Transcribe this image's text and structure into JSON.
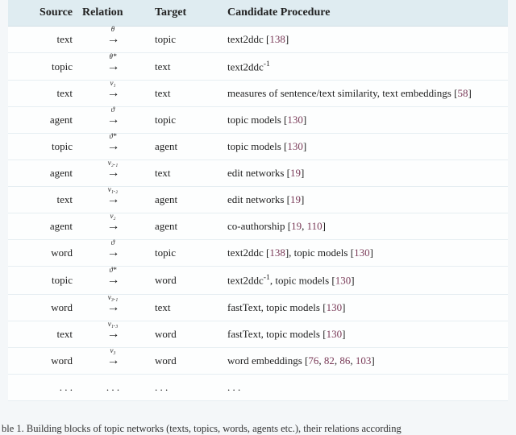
{
  "headers": {
    "source": "Source",
    "relation": "Relation",
    "target": "Target",
    "proc": "Candidate Procedure"
  },
  "rows": [
    {
      "source": "text",
      "rel_symbol": "θ",
      "target": "topic",
      "proc_parts": [
        {
          "t": "text2ddc ["
        },
        {
          "t": "138",
          "cite": true
        },
        {
          "t": "]"
        }
      ]
    },
    {
      "source": "topic",
      "rel_symbol": "θ*",
      "target": "text",
      "proc_parts": [
        {
          "t": "text2ddc"
        },
        {
          "sup": "-1"
        }
      ]
    },
    {
      "source": "text",
      "rel_symbol": "ν₁",
      "target": "text",
      "proc_parts": [
        {
          "t": "measures of sentence/text similarity, text embeddings ["
        },
        {
          "t": "58",
          "cite": true
        },
        {
          "t": "]"
        }
      ]
    },
    {
      "source": "agent",
      "rel_symbol": "ϑ",
      "target": "topic",
      "proc_parts": [
        {
          "t": "topic models ["
        },
        {
          "t": "130",
          "cite": true
        },
        {
          "t": "]"
        }
      ]
    },
    {
      "source": "topic",
      "rel_symbol": "ϑ*",
      "target": "agent",
      "proc_parts": [
        {
          "t": "topic models ["
        },
        {
          "t": "130",
          "cite": true
        },
        {
          "t": "]"
        }
      ]
    },
    {
      "source": "agent",
      "rel_symbol": "ν₂.₁",
      "target": "text",
      "proc_parts": [
        {
          "t": "edit networks ["
        },
        {
          "t": "19",
          "cite": true
        },
        {
          "t": "]"
        }
      ]
    },
    {
      "source": "text",
      "rel_symbol": "ν₁.₂",
      "target": "agent",
      "proc_parts": [
        {
          "t": "edit networks ["
        },
        {
          "t": "19",
          "cite": true
        },
        {
          "t": "]"
        }
      ]
    },
    {
      "source": "agent",
      "rel_symbol": "ν₂",
      "target": "agent",
      "proc_parts": [
        {
          "t": "co-authorship ["
        },
        {
          "t": "19",
          "cite": true
        },
        {
          "t": ", "
        },
        {
          "t": "110",
          "cite": true
        },
        {
          "t": "]"
        }
      ]
    },
    {
      "source": "word",
      "rel_symbol": "ϑ",
      "target": "topic",
      "proc_parts": [
        {
          "t": "text2ddc ["
        },
        {
          "t": "138",
          "cite": true
        },
        {
          "t": "], topic models ["
        },
        {
          "t": "130",
          "cite": true
        },
        {
          "t": "]"
        }
      ]
    },
    {
      "source": "topic",
      "rel_symbol": "ϑ*",
      "target": "word",
      "proc_parts": [
        {
          "t": "text2ddc"
        },
        {
          "sup": "-1"
        },
        {
          "t": ", topic models ["
        },
        {
          "t": "130",
          "cite": true
        },
        {
          "t": "]"
        }
      ]
    },
    {
      "source": "word",
      "rel_symbol": "ν₃.₁",
      "target": "text",
      "proc_parts": [
        {
          "t": "fastText, topic models ["
        },
        {
          "t": "130",
          "cite": true
        },
        {
          "t": "]"
        }
      ]
    },
    {
      "source": "text",
      "rel_symbol": "ν₁.₃",
      "target": "word",
      "proc_parts": [
        {
          "t": "fastText, topic models ["
        },
        {
          "t": "130",
          "cite": true
        },
        {
          "t": "]"
        }
      ]
    },
    {
      "source": "word",
      "rel_symbol": "ν₃",
      "target": "word",
      "proc_parts": [
        {
          "t": "word embeddings ["
        },
        {
          "t": "76",
          "cite": true
        },
        {
          "t": ", "
        },
        {
          "t": "82",
          "cite": true
        },
        {
          "t": ", "
        },
        {
          "t": "86",
          "cite": true
        },
        {
          "t": ", "
        },
        {
          "t": "103",
          "cite": true
        },
        {
          "t": "]"
        }
      ]
    },
    {
      "source": ". . .",
      "rel_symbol": ". . .",
      "target": ". . .",
      "proc_parts": [
        {
          "t": ". . ."
        }
      ],
      "plain_rel": true
    }
  ],
  "footer": "ble 1.  Building blocks of topic networks (texts, topics, words, agents etc.), their relations according"
}
